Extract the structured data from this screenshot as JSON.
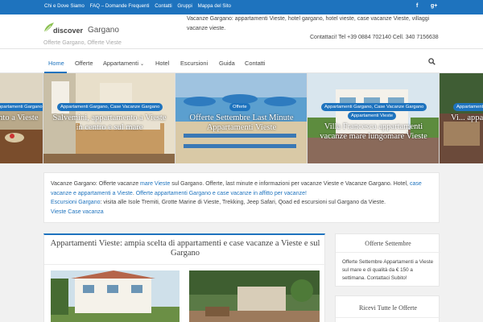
{
  "topbar": {
    "links": [
      "Chi e Dove Siamo",
      "FAQ – Domande Frequenti",
      "Contatti",
      "Gruppi",
      "Mappa del Sito"
    ],
    "social": [
      {
        "label": "f",
        "icon": "facebook-icon"
      },
      {
        "label": "g+",
        "icon": "google-plus-icon"
      }
    ]
  },
  "header": {
    "logo_part1": "discover",
    "logo_part2": "Gargano",
    "tagline": "Offerte Gargano, Offerte Vieste",
    "description": "Vacanze Gargano: appartamenti Vieste, hotel gargano, hotel vieste, case vacanze Vieste, villaggi vacanze vieste.",
    "contact": "Contattaci! Tel +39 0884 702140 Cell. 340 7156638"
  },
  "nav": {
    "items": [
      "Home",
      "Offerte",
      "Appartamenti",
      "Hotel",
      "Escursioni",
      "Guida",
      "Contatti"
    ],
    "dropdown_caret": "⌄"
  },
  "slider": {
    "slides": [
      {
        "cats": [
          "Appartamenti Gargano"
        ],
        "title": "...mento a Vieste"
      },
      {
        "cats": [
          "Appartamenti Gargano, Case Vacanze Gargano"
        ],
        "title": "Salvemini, appartamento a Vieste in centro e sul mare"
      },
      {
        "cats": [
          "Offerte"
        ],
        "title": "Offerte Settembre Last Minute Appartamenti Vieste"
      },
      {
        "cats": [
          "Appartamenti Gargano, Case Vacanze Gargano",
          "Appartamenti Vieste"
        ],
        "title": "Villa Francesca appartamenti vacanze mare lungomare Vieste"
      },
      {
        "cats": [
          "Appartamenti"
        ],
        "title": "Vi... appa..."
      }
    ]
  },
  "intro": {
    "line1_a": "Vacanze Gargano: Offerte vacanze ",
    "line1_link": "mare Vieste",
    "line1_b": " sul Gargano. Offerte, last minute e informazioni per vacanze Vieste e Vacanze Gargano. Hotel, ",
    "line1_link2": "case vacanze e appartamenti a Vieste",
    "line1_c": ". ",
    "line1_link3": "Offerte appartamenti Gargano e case vacanze in affitto per vacanze!",
    "line3_link": "Escursioni Gargano",
    "line3_text": ": visita alle Isole Tremiti, Grotte Marine di Vieste, Trekking, Jeep Safari, Qoad ed escursioni sul Gargano da Vieste.",
    "line4_link": "Vieste Case vacanza"
  },
  "main": {
    "title": "Appartamenti Vieste: ampia scelta di appartamenti e case vacanze a Vieste e sul Gargano"
  },
  "sidebar": {
    "widget1_title": "Offerte Settembre",
    "widget1_text": "Offerte Settembre Appartamenti a Vieste sul mare e di qualità da € 150 a settimana. Contattaci Subito!",
    "widget2_title": "Ricevi Tutte le Offerte"
  },
  "colors": {
    "accent": "#1e73be",
    "background": "#f1f1f1"
  }
}
